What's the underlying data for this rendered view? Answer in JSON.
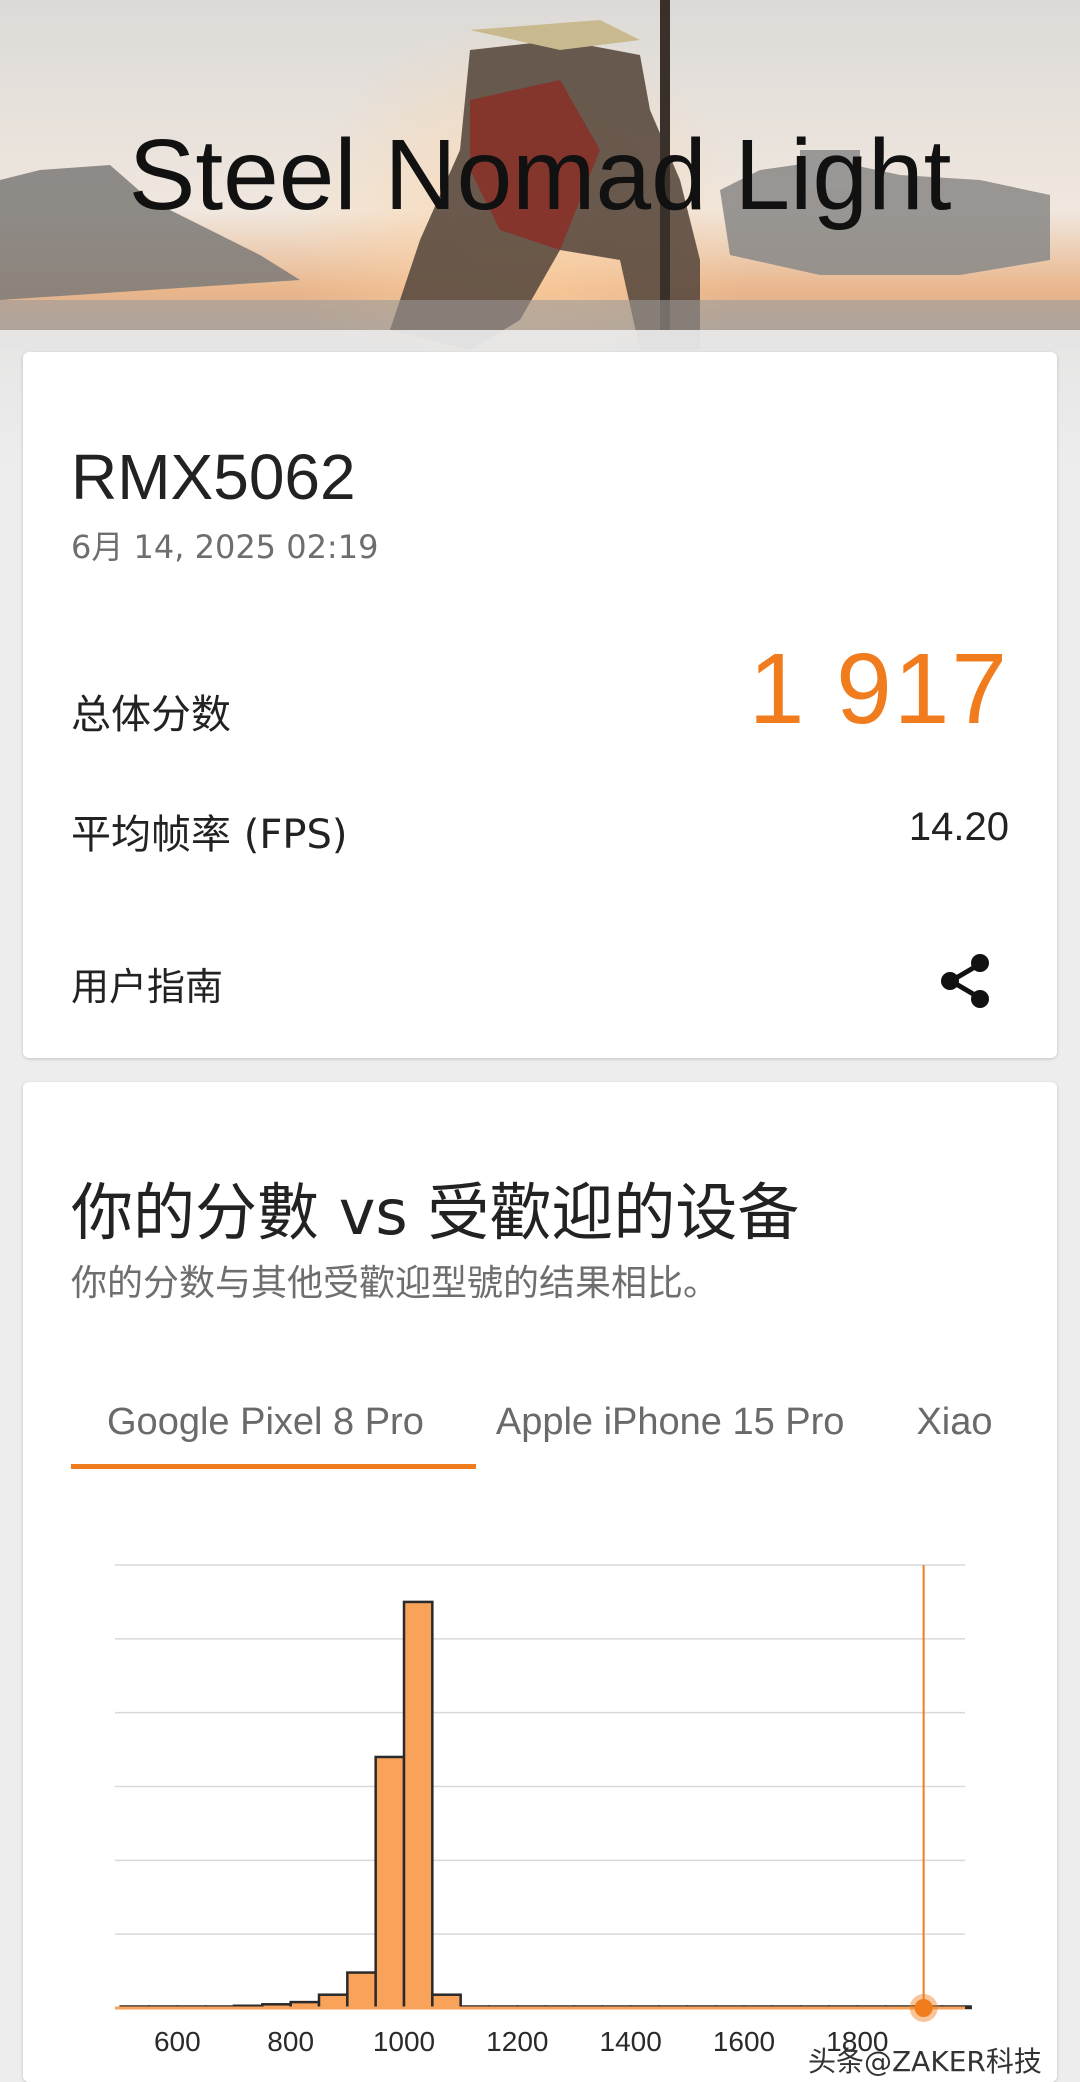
{
  "header": {
    "title": "Steel Nomad Light"
  },
  "result": {
    "device_name": "RMX5062",
    "date": "6月 14, 2025 02:19",
    "score_label": "总体分数",
    "score_value": "1 917",
    "fps_label": "平均帧率 (FPS)",
    "fps_value": "14.20",
    "guide_label": "用户指南",
    "share_icon": "share-icon"
  },
  "compare": {
    "title": "你的分數 vs 受歡迎的设备",
    "subtitle": "你的分数与其他受歡迎型號的结果相比。",
    "tabs": [
      {
        "label": "Google Pixel 8 Pro",
        "active": true
      },
      {
        "label": "Apple iPhone 15 Pro",
        "active": false
      },
      {
        "label": "Xiao",
        "active": false
      }
    ],
    "accent_color": "#f07c1e"
  },
  "chart_data": {
    "type": "bar",
    "title": "",
    "xlabel": "",
    "ylabel": "",
    "x_ticks": [
      600,
      800,
      1000,
      1200,
      1400,
      1600,
      1800
    ],
    "xlim": [
      490,
      1990
    ],
    "ylim": [
      0,
      6
    ],
    "grid": true,
    "marker_value": 1917,
    "series": [
      {
        "bins": [
          {
            "x": 500,
            "value": 0.02
          },
          {
            "x": 550,
            "value": 0.02
          },
          {
            "x": 600,
            "value": 0.02
          },
          {
            "x": 650,
            "value": 0.02
          },
          {
            "x": 700,
            "value": 0.03
          },
          {
            "x": 750,
            "value": 0.05
          },
          {
            "x": 800,
            "value": 0.08
          },
          {
            "x": 850,
            "value": 0.18
          },
          {
            "x": 900,
            "value": 0.48
          },
          {
            "x": 950,
            "value": 3.4
          },
          {
            "x": 1000,
            "value": 5.5
          },
          {
            "x": 1050,
            "value": 0.18
          },
          {
            "x": 1100,
            "value": 0.02
          },
          {
            "x": 1150,
            "value": 0.02
          },
          {
            "x": 1200,
            "value": 0.02
          },
          {
            "x": 1250,
            "value": 0.02
          },
          {
            "x": 1300,
            "value": 0.02
          },
          {
            "x": 1350,
            "value": 0.02
          },
          {
            "x": 1400,
            "value": 0.02
          },
          {
            "x": 1450,
            "value": 0.02
          },
          {
            "x": 1500,
            "value": 0.02
          },
          {
            "x": 1550,
            "value": 0.02
          },
          {
            "x": 1600,
            "value": 0.02
          },
          {
            "x": 1650,
            "value": 0.02
          },
          {
            "x": 1700,
            "value": 0.02
          },
          {
            "x": 1750,
            "value": 0.02
          },
          {
            "x": 1800,
            "value": 0.02
          },
          {
            "x": 1850,
            "value": 0.02
          },
          {
            "x": 1900,
            "value": 0.02
          },
          {
            "x": 1950,
            "value": 0.02
          }
        ],
        "color": "#f9a25a"
      }
    ]
  },
  "watermark": "头条@ZAKER科技"
}
